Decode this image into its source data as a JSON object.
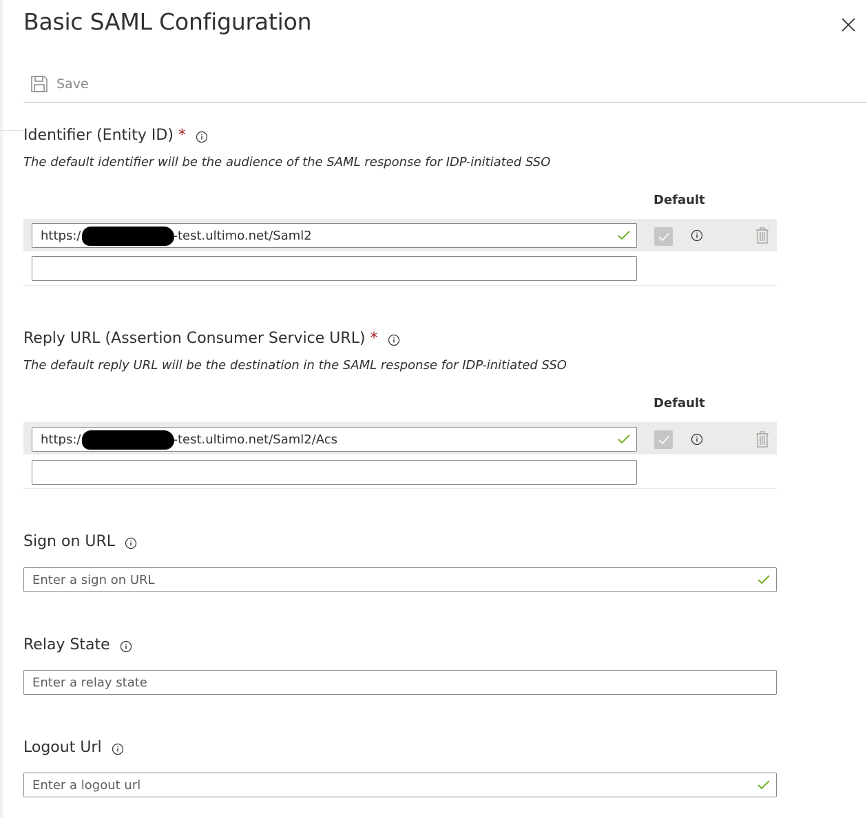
{
  "panel": {
    "title": "Basic SAML Configuration"
  },
  "toolbar": {
    "save_label": "Save"
  },
  "identifier": {
    "label": "Identifier (Entity ID)",
    "required_mark": "*",
    "description": "The default identifier will be the audience of the SAML response for IDP-initiated SSO",
    "default_header": "Default",
    "rows": [
      {
        "prefix": "https:/",
        "suffix": "-test.ultimo.net/Saml2",
        "is_default": true
      }
    ],
    "empty_input_value": ""
  },
  "reply_url": {
    "label": "Reply URL (Assertion Consumer Service URL)",
    "required_mark": "*",
    "description": "The default reply URL will be the destination in the SAML response for IDP-initiated SSO",
    "default_header": "Default",
    "rows": [
      {
        "prefix": "https:/",
        "suffix": "-test.ultimo.net/Saml2/Acs",
        "is_default": true
      }
    ],
    "empty_input_value": ""
  },
  "sign_on_url": {
    "label": "Sign on URL",
    "placeholder": "Enter a sign on URL",
    "value": ""
  },
  "relay_state": {
    "label": "Relay State",
    "placeholder": "Enter a relay state",
    "value": ""
  },
  "logout_url": {
    "label": "Logout Url",
    "placeholder": "Enter a logout url",
    "value": ""
  },
  "colors": {
    "required": "#a4262c",
    "valid_check": "#57a300",
    "border": "#8a8886",
    "row_highlight": "#edebe9"
  },
  "icons": [
    "close-icon",
    "save-icon",
    "info-icon",
    "checkmark-icon",
    "trash-icon"
  ]
}
